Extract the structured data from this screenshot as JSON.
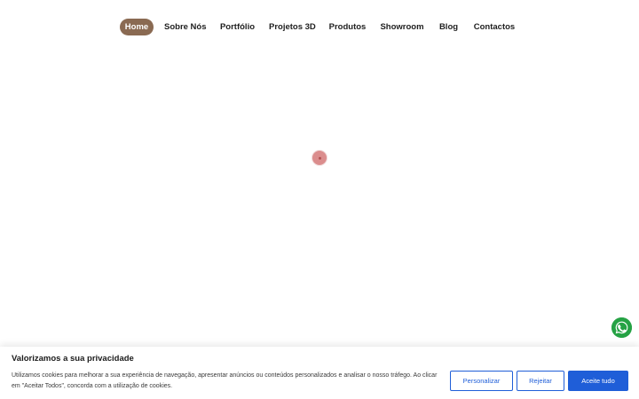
{
  "nav": {
    "items": [
      {
        "label": "Home",
        "active": true
      },
      {
        "label": "Sobre Nós",
        "active": false
      },
      {
        "label": "Portfólio",
        "active": false
      },
      {
        "label": "Projetos 3D",
        "active": false
      },
      {
        "label": "Produtos",
        "active": false
      },
      {
        "label": "Showroom",
        "active": false
      },
      {
        "label": "Blog",
        "active": false
      },
      {
        "label": "Contactos",
        "active": false
      }
    ]
  },
  "loader": {
    "icon": "loading-spinner-icon",
    "color": "#db8d8d"
  },
  "whatsapp": {
    "icon": "whatsapp-icon",
    "color": "#25a244"
  },
  "cookie_banner": {
    "title": "Valorizamos a sua privacidade",
    "text": "Utilizamos cookies para melhorar a sua experiência de navegação, apresentar anúncios ou conteúdos personalizados e analisar o nosso tráfego. Ao clicar em \"Aceitar Todos\", concorda com a utilização de cookies.",
    "buttons": {
      "customize": "Personalizar",
      "reject": "Rejeitar",
      "accept": "Aceite tudo"
    },
    "accent_color": "#1f5ed8"
  },
  "colors": {
    "nav_active_bg": "#8a6a52"
  }
}
